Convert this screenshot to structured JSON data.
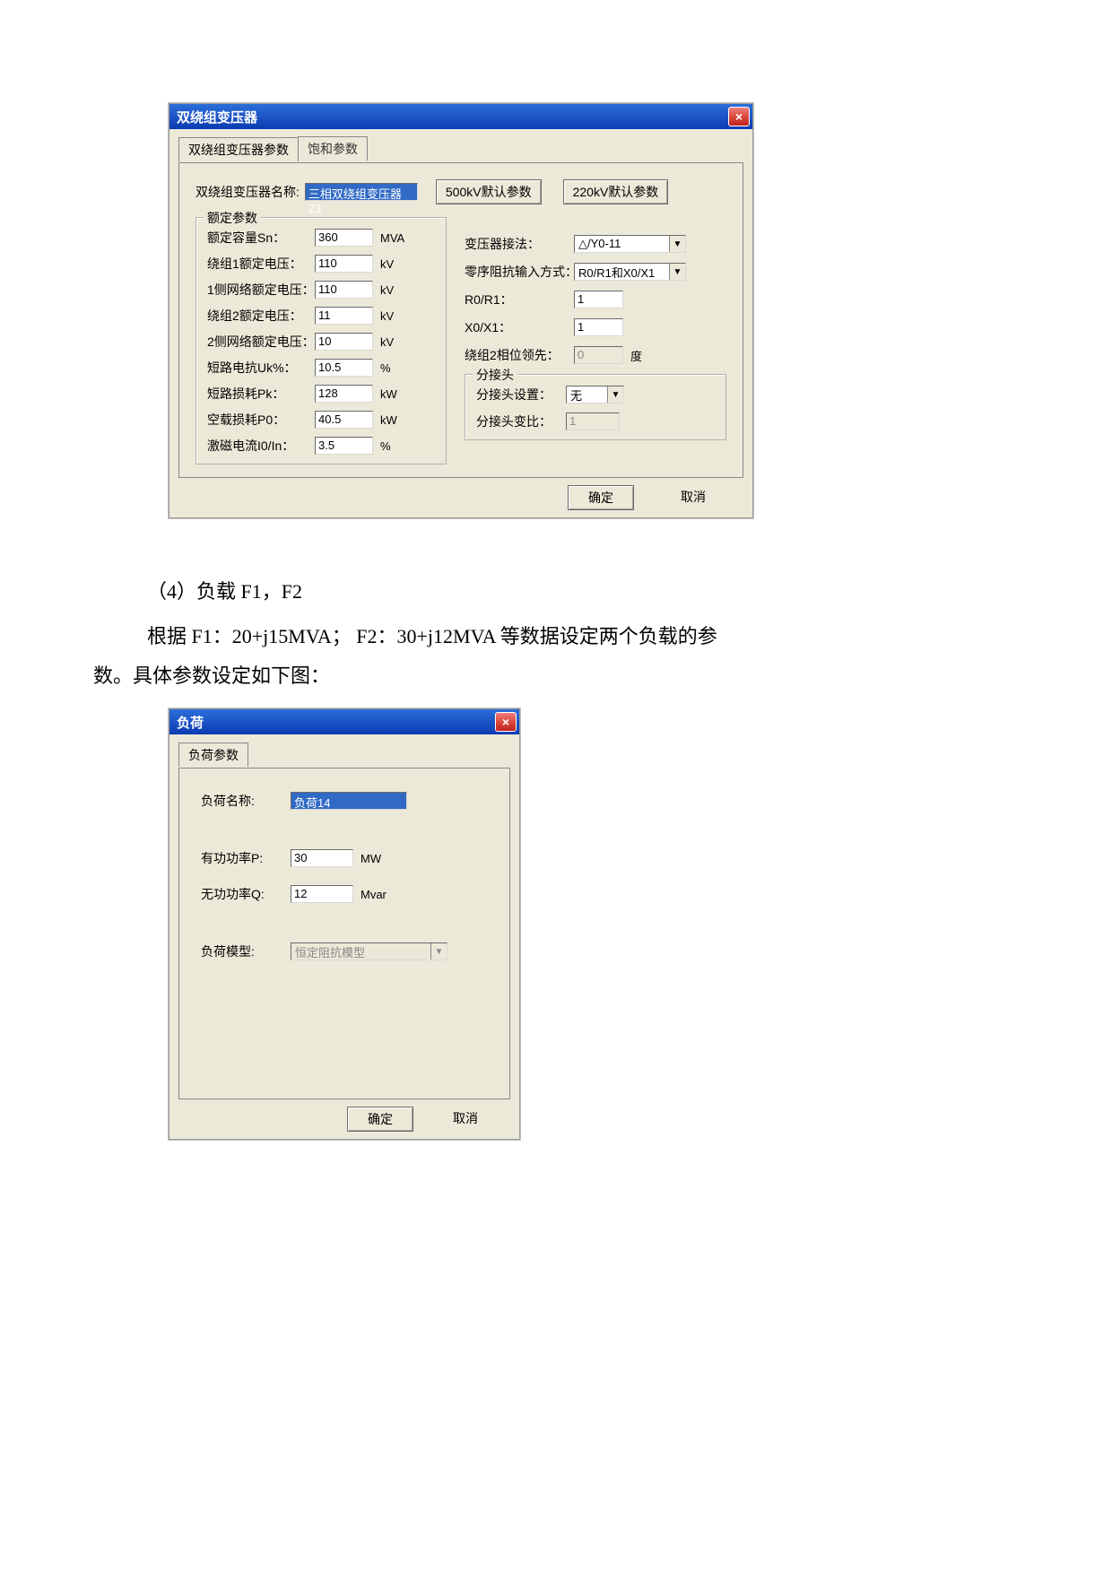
{
  "dialog1": {
    "title": "双绕组变压器",
    "tabs": {
      "tab1": "双绕组变压器参数",
      "tab2": "饱和参数"
    },
    "name_label": "双绕组变压器名称:",
    "name_value": "三相双绕组变压器23",
    "btn_500kv": "500kV默认参数",
    "btn_220kv": "220kV默认参数",
    "group_rating_title": "额定参数",
    "rows": {
      "sn": {
        "label": "额定容量Sn：",
        "value": "360",
        "unit": "MVA"
      },
      "w1v": {
        "label": "绕组1额定电压：",
        "value": "110",
        "unit": "kV"
      },
      "n1v": {
        "label": "1侧网络额定电压：",
        "value": "110",
        "unit": "kV"
      },
      "w2v": {
        "label": "绕组2额定电压：",
        "value": "11",
        "unit": "kV"
      },
      "n2v": {
        "label": "2侧网络额定电压：",
        "value": "10",
        "unit": "kV"
      },
      "uk": {
        "label": "短路电抗Uk%：",
        "value": "10.5",
        "unit": "%"
      },
      "pk": {
        "label": "短路损耗Pk：",
        "value": "128",
        "unit": "kW"
      },
      "p0": {
        "label": "空载损耗P0：",
        "value": "40.5",
        "unit": "kW"
      },
      "i0": {
        "label": "激磁电流I0/In：",
        "value": "3.5",
        "unit": "%"
      }
    },
    "right": {
      "conn_label": "变压器接法：",
      "conn_value": "△/Y0-11",
      "zero_label": "零序阻抗输入方式：",
      "zero_value": "R0/R1和X0/X1",
      "r0r1_label": "R0/R1：",
      "r0r1_value": "1",
      "x0x1_label": "X0/X1：",
      "x0x1_value": "1",
      "phase_label": "绕组2相位领先：",
      "phase_value": "0",
      "phase_unit": "度"
    },
    "tap_group_title": "分接头",
    "tap_setting_label": "分接头设置：",
    "tap_setting_value": "无",
    "tap_ratio_label": "分接头变比：",
    "tap_ratio_value": "1",
    "ok": "确定",
    "cancel": "取消"
  },
  "doc": {
    "line1": "（4）负载 F1，F2",
    "line2": "根据 F1：20+j15MVA； F2：30+j12MVA 等数据设定两个负载的参",
    "line3": "数。具体参数设定如下图："
  },
  "dialog2": {
    "title": "负荷",
    "tab": "负荷参数",
    "name_label": "负荷名称:",
    "name_value": "负荷14",
    "p_label": "有功功率P:",
    "p_value": "30",
    "p_unit": "MW",
    "q_label": "无功功率Q:",
    "q_value": "12",
    "q_unit": "Mvar",
    "model_label": "负荷模型:",
    "model_value": "恒定阻抗模型",
    "ok": "确定",
    "cancel": "取消"
  }
}
